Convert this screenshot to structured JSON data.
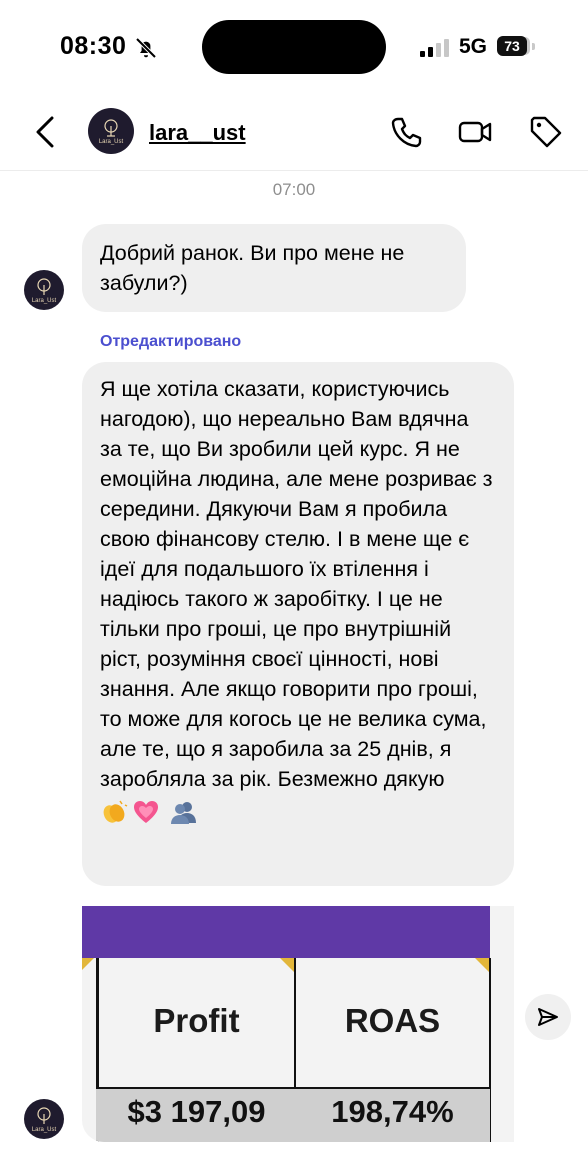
{
  "status_bar": {
    "time": "08:30",
    "network": "5G",
    "battery": "73"
  },
  "header": {
    "username": "lara__ust",
    "avatar_text": "Lara_Ust"
  },
  "chat": {
    "timestamp": "07:00",
    "messages": [
      {
        "text": "Добрий ранок. Ви про мене не забули?)"
      },
      {
        "edited_label": "Отредактировано",
        "text": "Я ще хотіла сказати, користуючись нагодою), що нереально Вам вдячна за те, що Ви зробили цей курс. Я не емоційна людина, але мене розриває з середини. Дякуючи Вам я пробила свою фінансову стелю. І в мене ще є ідеї для подальшого їх втілення і надіюсь такого ж заробітку. І це не тільки про гроші, це про внутрішній ріст, розуміння своєї цінності, нові знання. Але якщо говорити про гроші, то може для когось це не велика сума, але те, що я заробила за 25 днів, я заробляла за рік. Безмежно дякую",
        "emojis": [
          "clapping-hands",
          "growing-heart",
          "two-people-silhouette"
        ]
      }
    ],
    "image_table": {
      "headers": [
        "Profit",
        "ROAS"
      ],
      "values": [
        "$3 197,09",
        "198,74%"
      ]
    }
  },
  "colors": {
    "bubble": "#efefef",
    "edited": "#4b4fcf",
    "table_header_band": "#5f39a6"
  }
}
